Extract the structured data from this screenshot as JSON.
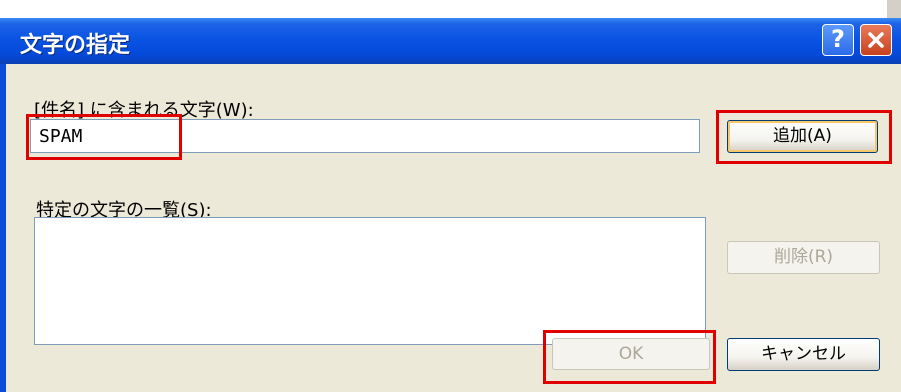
{
  "dialog": {
    "title": "文字の指定",
    "help_label": "?",
    "subject_label": "[件名] に含まれる文字(W):",
    "subject_value": "SPAM",
    "list_label": "特定の文字の一覧(S):",
    "buttons": {
      "add": "追加(A)",
      "delete": "削除(R)",
      "ok": "OK",
      "cancel": "キャンセル"
    }
  },
  "colors": {
    "titlebar": "#0A54E3",
    "face": "#ECE9D8",
    "highlight": "#E00000"
  },
  "icons": [
    "help-icon",
    "close-icon"
  ]
}
